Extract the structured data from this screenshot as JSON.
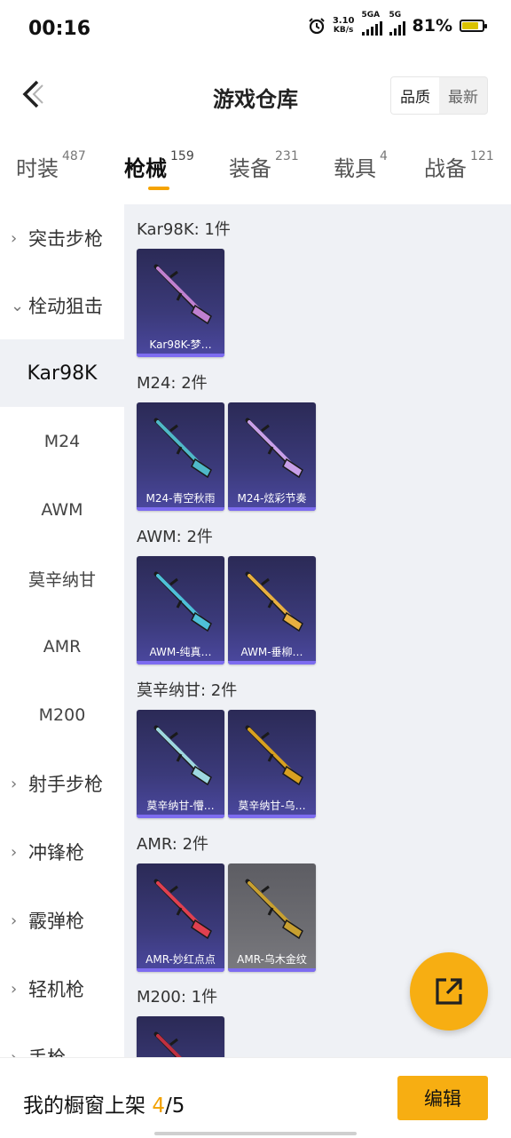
{
  "status_bar": {
    "time": "00:16",
    "net_speed_value": "3.10",
    "net_speed_unit": "KB/s",
    "network_1": "5GA",
    "network_2": "5G",
    "battery": "81%",
    "battery_level": 0.81
  },
  "header": {
    "title": "游戏仓库",
    "sort_options": [
      "品质",
      "最新"
    ],
    "sort_selected": "品质"
  },
  "tabs": [
    {
      "label": "时装",
      "count": "487"
    },
    {
      "label": "枪械",
      "count": "159",
      "active": true
    },
    {
      "label": "装备",
      "count": "231"
    },
    {
      "label": "载具",
      "count": "4"
    },
    {
      "label": "战备",
      "count": "121"
    }
  ],
  "sidebar": {
    "items": [
      {
        "label": "突击步枪",
        "type": "group",
        "chevron": "›"
      },
      {
        "label": "栓动狙击",
        "type": "group",
        "chevron": "⌄"
      },
      {
        "label": "Kar98K",
        "type": "sub",
        "selected": true
      },
      {
        "label": "M24",
        "type": "sub"
      },
      {
        "label": "AWM",
        "type": "sub"
      },
      {
        "label": "莫辛纳甘",
        "type": "sub"
      },
      {
        "label": "AMR",
        "type": "sub"
      },
      {
        "label": "M200",
        "type": "sub"
      },
      {
        "label": "射手步枪",
        "type": "group",
        "chevron": "›"
      },
      {
        "label": "冲锋枪",
        "type": "group",
        "chevron": "›"
      },
      {
        "label": "霰弹枪",
        "type": "group",
        "chevron": "›"
      },
      {
        "label": "轻机枪",
        "type": "group",
        "chevron": "›"
      },
      {
        "label": "手枪",
        "type": "group",
        "chevron": "›"
      }
    ]
  },
  "sections": [
    {
      "title": "Kar98K: 1件",
      "items": [
        {
          "label": "Kar98K-梦…",
          "color": "#c080d0"
        }
      ]
    },
    {
      "title": "M24: 2件",
      "items": [
        {
          "label": "M24-青空秋雨",
          "color": "#4fb8c8"
        },
        {
          "label": "M24-炫彩节奏",
          "color": "#c8a0e8"
        }
      ]
    },
    {
      "title": "AWM: 2件",
      "items": [
        {
          "label": "AWM-纯真…",
          "color": "#4ec0d8"
        },
        {
          "label": "AWM-垂柳…",
          "color": "#e8b040"
        }
      ]
    },
    {
      "title": "莫辛纳甘: 2件",
      "items": [
        {
          "label": "莫辛纳甘-懵…",
          "color": "#9ed8e0"
        },
        {
          "label": "莫辛纳甘-乌…",
          "color": "#d8a020"
        }
      ]
    },
    {
      "title": "AMR: 2件",
      "items": [
        {
          "label": "AMR-妙红点点",
          "color": "#e04050"
        },
        {
          "label": "AMR-乌木金纹",
          "color": "#c8a030",
          "gray": true
        }
      ]
    },
    {
      "title": "M200: 1件",
      "items": [
        {
          "label": "",
          "color": "#c03040"
        }
      ]
    }
  ],
  "footer": {
    "prefix": "我的橱窗上架 ",
    "count": "4",
    "suffix": "/5",
    "edit_label": "编辑"
  },
  "icons": {
    "back": "chevron-left-icon",
    "share": "share-icon"
  }
}
